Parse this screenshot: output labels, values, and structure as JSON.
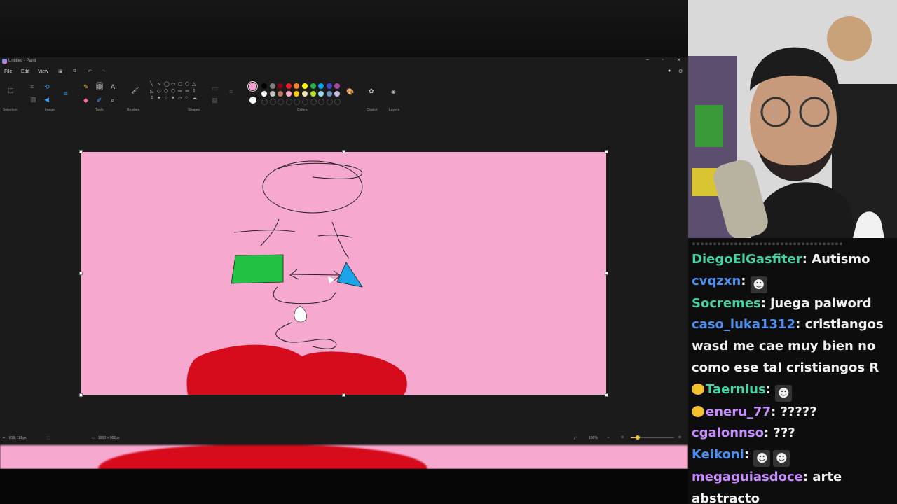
{
  "window": {
    "title": "Untitled - Paint",
    "controls": [
      "–",
      "▫",
      "✕"
    ]
  },
  "menu": {
    "file": "File",
    "edit": "Edit",
    "view": "View"
  },
  "ribbon": {
    "groups": {
      "selection": "Selection",
      "image": "Image",
      "tools": "Tools",
      "brushes": "Brushes",
      "shapes": "Shapes",
      "colors": "Colors",
      "copilot": "Copilot",
      "layers": "Layers"
    },
    "palette_row1": [
      "#000000",
      "#7f7f7f",
      "#880015",
      "#ed1c24",
      "#ff7f27",
      "#fff200",
      "#22b14c",
      "#00a2e8",
      "#3f48cc",
      "#a349a4"
    ],
    "palette_row2": [
      "#ffffff",
      "#c3c3c3",
      "#b97a57",
      "#ffaec9",
      "#ffc90e",
      "#efe4b0",
      "#b5e61d",
      "#99d9ea",
      "#7092be",
      "#c8bfe7"
    ],
    "primary_color": "#f79fcf",
    "secondary_color": "#ffffff"
  },
  "canvas": {
    "background": "#f7a8cf"
  },
  "statusbar": {
    "cursor_pos": "819, 185px",
    "canvas_size": "1950 × 902px",
    "zoom": "100%"
  },
  "chat": {
    "messages": [
      {
        "user": "DiegoElGasfiter",
        "color": "#44d2a6",
        "text": "Autismo"
      },
      {
        "user": "cvqzxn",
        "color": "#4d8ff0",
        "text": "",
        "emotes": 1
      },
      {
        "user": "Socremes",
        "color": "#44d2a6",
        "text": "juega palword"
      },
      {
        "user": "caso_luka1312",
        "color": "#4d8ff0",
        "text": "cristiangos wasd me cae muy bien no como ese tal cristiangos R"
      },
      {
        "user": "Taernius",
        "color": "#44d2a6",
        "text": "",
        "emotes": 1,
        "badge": true
      },
      {
        "user": "eneru_77",
        "color": "#c78cff",
        "text": "?????",
        "badge": true
      },
      {
        "user": "cgalonnso",
        "color": "#c78cff",
        "text": "???"
      },
      {
        "user": "Keikoni",
        "color": "#4d8ff0",
        "text": "",
        "emotes": 2
      },
      {
        "user": "megaguiasdoce",
        "color": "#c78cff",
        "text": "arte abstracto"
      }
    ]
  }
}
